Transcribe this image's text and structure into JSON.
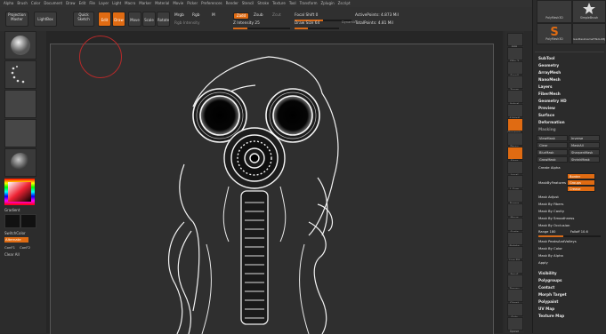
{
  "menu": [
    "Alpha",
    "Brush",
    "Color",
    "Document",
    "Draw",
    "Edit",
    "File",
    "Layer",
    "Light",
    "Macro",
    "Marker",
    "Material",
    "Movie",
    "Picker",
    "Preferences",
    "Render",
    "Stencil",
    "Stroke",
    "Texture",
    "Tool",
    "Transform",
    "Zplugin",
    "Zscript"
  ],
  "toolbar": {
    "projection_master": "Projection Master",
    "lightbox": "LightBox",
    "quick_sketch": "Quick Sketch",
    "edit": "Edit",
    "draw": "Draw",
    "move": "Move",
    "scale": "Scale",
    "rotate": "Rotate",
    "mrgb": "Mrgb",
    "rgb": "Rgb",
    "m": "M",
    "zadd": "Zadd",
    "zsub": "Zsub",
    "zcut": "Zcut",
    "rgb_intensity": "Rgb Intensity",
    "z_intensity": "Z Intensity 25",
    "focal_shift": "Focal Shift 0",
    "draw_size": "Draw Size 64",
    "dynamic": "Dynamic",
    "active_points": "ActivePoints: 4.873 Mil",
    "total_points": "TotalPoints: 4.81 Mil"
  },
  "left_panel": {
    "gradient": "Gradient",
    "switch_color": "SwitchColor",
    "alternate": "Alternate",
    "conf1": "ConF1",
    "conf2": "ConF2",
    "clear_all": "Clear All"
  },
  "right_tools": [
    "BPR",
    "SPix 3",
    "Scroll",
    "Zoom",
    "Actual",
    "AAHalf",
    "Dynamic",
    "Persp",
    "Floor",
    "Local",
    "L.Sym",
    "Frame",
    "Move",
    "Scale",
    "Rotate",
    "Line Fill",
    "PolyF",
    "Transp",
    "Ghost",
    "Solo",
    "Xpose"
  ],
  "tray": {
    "tool_thumb_1": "PolyMesh3D",
    "tool_thumb_2": "SimpleBrush",
    "tool_thumb_3": "PolyMesh3D",
    "tool_thumb_4": "GasMaskGameFINALOBJ",
    "sections_top": [
      "SubTool",
      "Geometry",
      "ArrayMesh",
      "NanoMesh",
      "Layers",
      "FiberMesh",
      "Geometry HD",
      "Preview",
      "Surface",
      "Deformation",
      "Masking"
    ],
    "masking_buttons": [
      "ViewMask",
      "Inverse",
      "Clear",
      "MaskAll",
      "BlurMask",
      "SharpenMask",
      "GrowMask",
      "ShrinkMask"
    ],
    "create_alpha": "Create Alpha",
    "mask_by_features": "MaskByFeatures",
    "feature_options": [
      "Border",
      "Groups",
      "Crease"
    ],
    "mask_items": [
      "Mask Adjust",
      "Mask By Fibers",
      "Mask By Cavity",
      "Mask By Smoothness",
      "Mask By Occlusion"
    ],
    "range_label": "Range 180",
    "falloff_label": "Falloff 10.6",
    "mask_items2": [
      "Mask PeaksAndValleys",
      "Mask By Color",
      "Mask By Alpha",
      "Apply"
    ],
    "sections_bottom": [
      "Visibility",
      "Polygroups",
      "Contact",
      "Morph Target",
      "Polypaint",
      "UV Map",
      "Texture Map"
    ]
  },
  "accent_color": "#e06b12"
}
